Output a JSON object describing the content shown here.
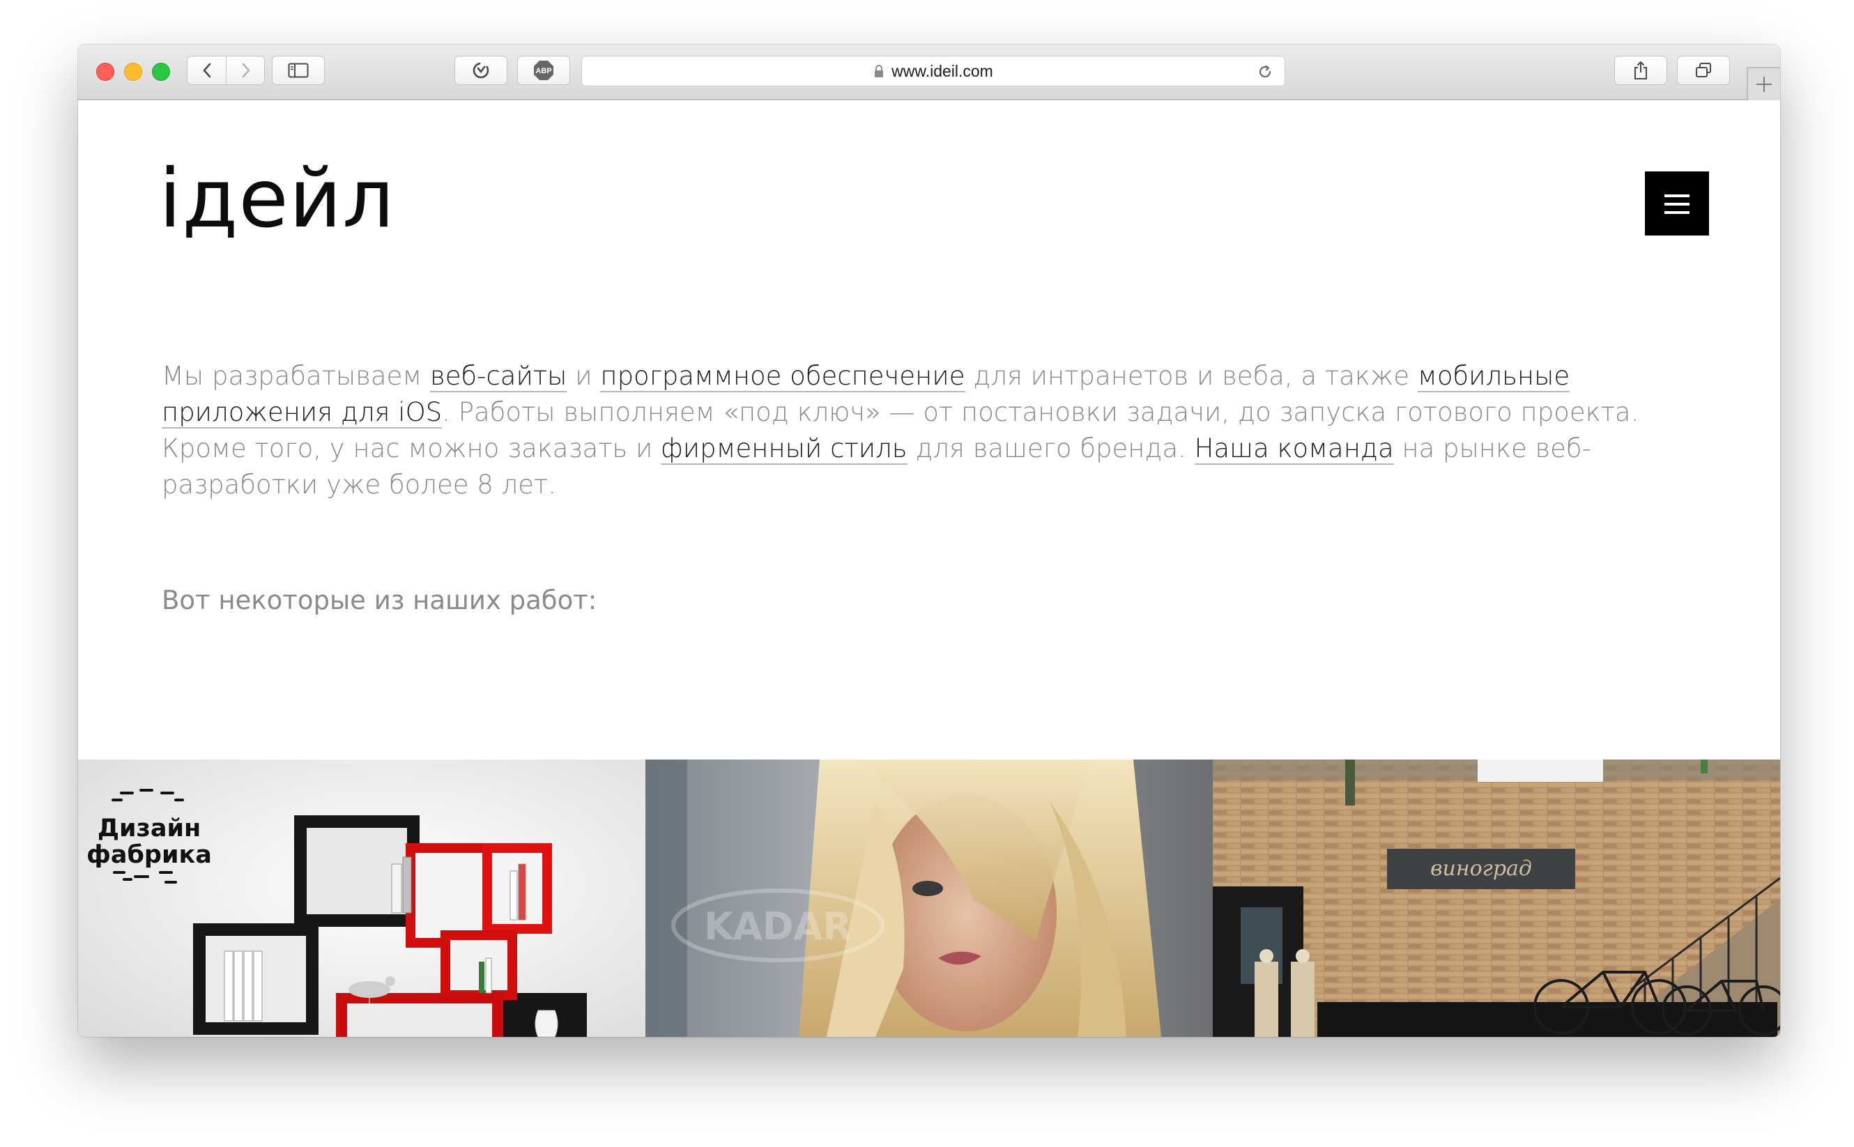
{
  "browser": {
    "url": "www.ideil.com",
    "buttons": [
      "back",
      "forward",
      "sidebar",
      "extension",
      "adblock",
      "share",
      "tabs",
      "new-tab"
    ],
    "adblock_label": "ABP"
  },
  "site": {
    "logo": "ідейл",
    "intro": {
      "t1": "Мы разрабатываем ",
      "link_web": "веб-сайты",
      "t2": " и ",
      "link_software": "программное обеспечение",
      "t3": " для интранетов и веба, а также ",
      "link_mobile": "мобильные приложения для iOS",
      "t4": ". Работы выполняем «под ключ» — от постановки задачи, до запуска готового проекта. Кроме того, у нас можно заказать и ",
      "link_branding": "фирменный стиль",
      "t5": " для вашего бренда. ",
      "link_team": "Наша команда",
      "t6": " на рынке веб-разработки уже более 8 лет."
    },
    "works_intro": "Вот некоторые из наших работ:",
    "portfolio": [
      {
        "logo_line1": "Дизайн",
        "logo_line2": "фабрика"
      },
      {
        "watermark": "KADAR"
      },
      {
        "sign": "виноград"
      }
    ]
  }
}
